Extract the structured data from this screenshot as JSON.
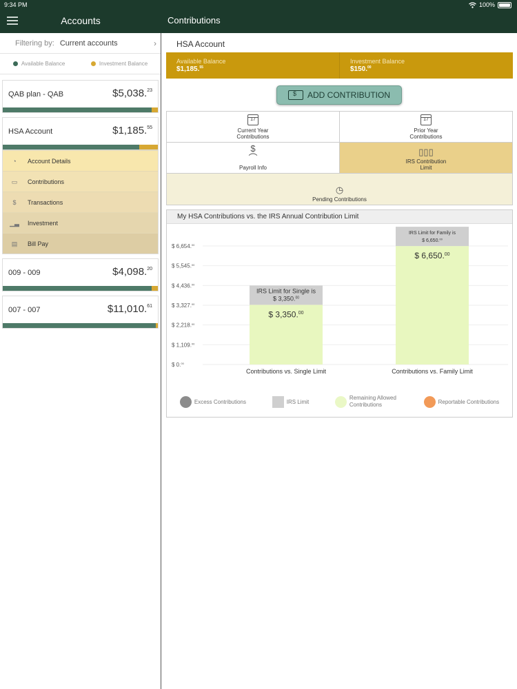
{
  "status": {
    "time": "9:34 PM",
    "battery": "100%"
  },
  "header": {
    "left_title": "Accounts",
    "right_title": "Contributions"
  },
  "sidebar": {
    "filter_label": "Filtering by:",
    "filter_value": "Current accounts",
    "legend": [
      {
        "label": "Available Balance",
        "color": "#3c6b58"
      },
      {
        "label": "Investment Balance",
        "color": "#d7a833"
      }
    ],
    "accounts": [
      {
        "name": "QAB plan - QAB",
        "amount": "$5,038.",
        "cents": "23",
        "available_fraction": 0.96
      },
      {
        "name": "HSA Account",
        "amount": "$1,185.",
        "cents": "55",
        "available_fraction": 0.88
      },
      {
        "name": "009 - 009",
        "amount": "$4,098.",
        "cents": "20",
        "available_fraction": 0.96
      },
      {
        "name": "007 - 007",
        "amount": "$11,010.",
        "cents": "61",
        "available_fraction": 0.985
      }
    ],
    "submenu": [
      {
        "label": "Account Details",
        "icon": "hand-coin-icon",
        "bg": "#f8e7ad"
      },
      {
        "label": "Contributions",
        "icon": "cash-icon",
        "bg": "#f2e2b4"
      },
      {
        "label": "Transactions",
        "icon": "dollar-circle-icon",
        "bg": "#eddcb2"
      },
      {
        "label": "Investment",
        "icon": "bar-growth-icon",
        "bg": "#e5d6ae"
      },
      {
        "label": "Bill Pay",
        "icon": "bill-icon",
        "bg": "#ddcda4"
      }
    ]
  },
  "account_panel": {
    "title": "HSA Account",
    "available_label": "Available Balance",
    "available_value": "$1,185.",
    "available_cents": "55",
    "investment_label": "Investment Balance",
    "investment_value": "$150.",
    "investment_cents": "00",
    "add_button": "ADD CONTRIBUTION"
  },
  "tiles": {
    "current_year": "Current Year Contributions",
    "current_year_day": "17",
    "prior_year": "Prior Year Contributions",
    "prior_year_day": "17",
    "payroll": "Payroll Info",
    "irs_limit": "IRS Contribution Limit",
    "pending": "Pending Contributions"
  },
  "chart_data": {
    "type": "bar",
    "title": "My HSA Contributions vs. the IRS Annual Contribution Limit",
    "y_ticks": [
      "$ 0.",
      "$ 1,109.",
      "$ 2,218.",
      "$ 3,327.",
      "$ 4,436.",
      "$ 5,545.",
      "$ 6,654."
    ],
    "y_tick_sup": "00",
    "ylim": [
      0,
      6654
    ],
    "categories": [
      "Contributions vs. Single Limit",
      "Contributions vs. Family Limit"
    ],
    "values": [
      3350,
      6650
    ],
    "value_labels": [
      "$ 3,350.",
      "$ 6,650."
    ],
    "value_label_sup": "00",
    "limit_labels": [
      {
        "line1": "IRS Limit for Single is",
        "line2": "$ 3,350."
      },
      {
        "line1": "IRS Limit for Family is",
        "line2": "$ 6,650."
      }
    ],
    "legend": [
      {
        "label": "Excess Contributions",
        "color": "#8c8c8c",
        "shape": "circle"
      },
      {
        "label": "IRS Limit",
        "color": "#cfcfcf",
        "shape": "square"
      },
      {
        "label": "Remaining Allowed Contributions",
        "color": "#eaf8c6",
        "shape": "circle"
      },
      {
        "label": "Reportable Contributions",
        "color": "#f29a58",
        "shape": "circle"
      }
    ],
    "colors": {
      "bar": "#e8f7bf",
      "limit": "#cfcfcf"
    },
    "grid": true,
    "legend_position": "bottom"
  }
}
